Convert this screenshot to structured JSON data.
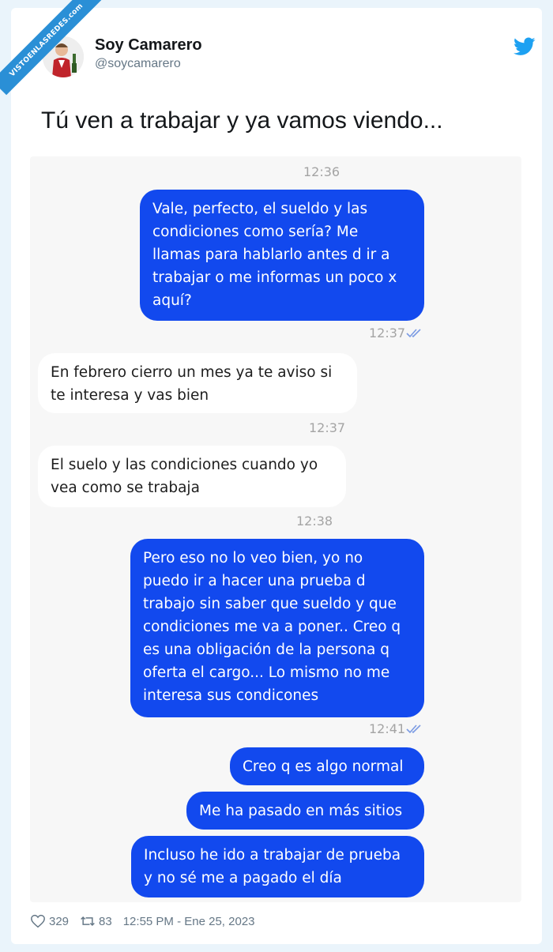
{
  "watermark": {
    "text": "VISTOENLASREDES.com"
  },
  "tweet": {
    "author_name": "Soy Camarero",
    "author_handle": "@soycamarero",
    "text": "Tú ven a trabajar y ya vamos viendo...",
    "likes": "329",
    "retweets": "83",
    "timestamp": "12:55 PM - Ene 25, 2023"
  },
  "chat": {
    "messages": [
      {
        "time": "12:36"
      },
      {
        "from": "me",
        "text": "Vale, perfecto, el sueldo y las\ncondiciones como sería? Me\nllamas para hablarlo antes d ir a\ntrabajar o me informas un poco x\naquí?",
        "time": "12:37"
      },
      {
        "from": "them",
        "text": "En febrero cierro un mes ya te aviso si\nte interesa y vas bien",
        "time": "12:37"
      },
      {
        "from": "them",
        "text": "El suelo y las condiciones cuando yo\nvea como se trabaja",
        "time": "12:38"
      },
      {
        "from": "me",
        "text": "Pero eso no lo veo bien, yo no\npuedo ir a hacer una prueba d\ntrabajo sin saber que sueldo y que\ncondiciones me va a poner.. Creo q\nes una obligación de la persona q\noferta el cargo... Lo mismo no me\ninteresa sus condicones",
        "time": "12:41"
      },
      {
        "from": "me",
        "text": "Creo q es algo normal"
      },
      {
        "from": "me",
        "text": "Me ha pasado en más sitios"
      },
      {
        "from": "me",
        "text": "Incluso he ido a trabajar de prueba\ny no sé me a pagado el día"
      }
    ]
  },
  "colors": {
    "outgoing_bubble": "#1249ee",
    "incoming_bubble": "#ffffff",
    "twitter_blue": "#1da1f2",
    "watermark_blue": "#2a8fd6"
  }
}
